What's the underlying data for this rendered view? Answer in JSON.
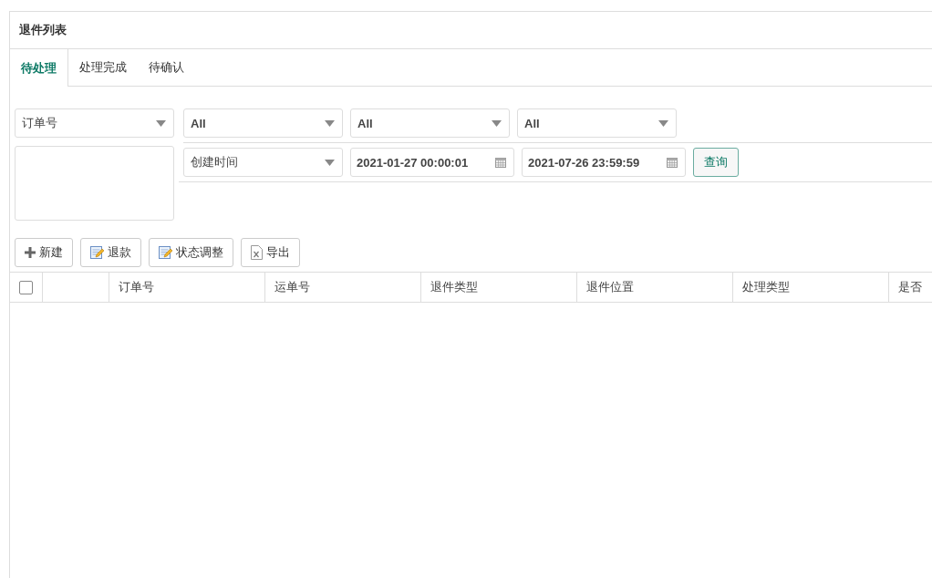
{
  "panel": {
    "title": "退件列表"
  },
  "tabs": [
    {
      "label": "待处理",
      "selected": true
    },
    {
      "label": "处理完成",
      "selected": false
    },
    {
      "label": "待确认",
      "selected": false
    }
  ],
  "filters": {
    "row_1": [
      {
        "value": "订单号",
        "bold": false
      },
      {
        "value": "All",
        "bold": true
      },
      {
        "value": "All",
        "bold": true
      },
      {
        "value": "All",
        "bold": true
      }
    ],
    "date_type": {
      "value": "创建时间",
      "bold": false
    },
    "start_date": {
      "value": "2021-01-27 00:00:01"
    },
    "end_date": {
      "value": "2021-07-26 23:59:59"
    },
    "search_button": "查询"
  },
  "toolbar": [
    {
      "kind": "add",
      "label": "新建"
    },
    {
      "kind": "edit",
      "label": "退款"
    },
    {
      "kind": "edit",
      "label": "状态调整"
    },
    {
      "kind": "excel",
      "label": "导出"
    }
  ],
  "table": {
    "select_all": {
      "checked": false
    },
    "columns": [
      "订单号",
      "运单号",
      "退件类型",
      "退件位置",
      "处理类型",
      "是否"
    ]
  }
}
